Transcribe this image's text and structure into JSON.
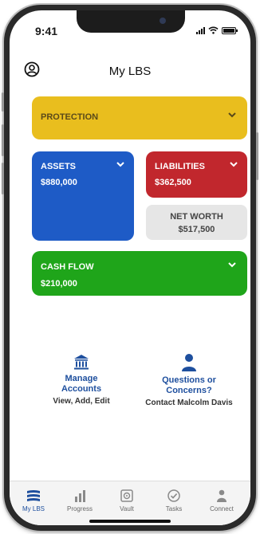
{
  "status_bar": {
    "time": "9:41"
  },
  "header": {
    "title": "My LBS"
  },
  "cards": {
    "protection": {
      "label": "PROTECTION",
      "color": "#e9be1e"
    },
    "assets": {
      "label": "ASSETS",
      "value": "$880,000",
      "color": "#1e5bc6"
    },
    "liabilities": {
      "label": "LIABILITIES",
      "value": "$362,500",
      "color": "#c1272d"
    },
    "net_worth": {
      "label": "NET WORTH",
      "value": "$517,500"
    },
    "cash_flow": {
      "label": "CASH FLOW",
      "value": "$210,000",
      "color": "#1fa51a"
    }
  },
  "actions": {
    "manage": {
      "title_line1": "Manage",
      "title_line2": "Accounts",
      "subtitle": "View, Add, Edit",
      "icon": "bank-icon"
    },
    "questions": {
      "title_line1": "Questions or",
      "title_line2": "Concerns?",
      "subtitle": "Contact Malcolm Davis",
      "icon": "person-icon"
    }
  },
  "tabbar": {
    "items": [
      {
        "label": "My LBS",
        "icon": "layers-icon",
        "active": true
      },
      {
        "label": "Progress",
        "icon": "bar-chart-icon",
        "active": false
      },
      {
        "label": "Vault",
        "icon": "vault-icon",
        "active": false
      },
      {
        "label": "Tasks",
        "icon": "check-circle-icon",
        "active": false
      },
      {
        "label": "Connect",
        "icon": "person-icon",
        "active": false
      }
    ]
  },
  "accent_color": "#1e4f9e"
}
